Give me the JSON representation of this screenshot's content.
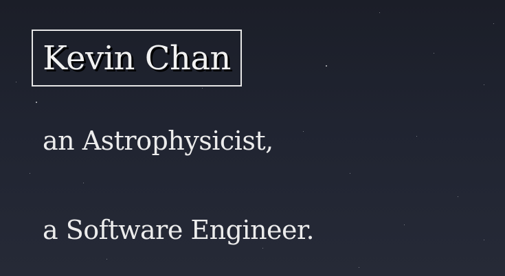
{
  "hero": {
    "name": "Kevin Chan",
    "taglines": [
      "an Astrophysicist,",
      "a Software Engineer."
    ]
  },
  "colors": {
    "background_top": "#1b1e28",
    "background_bottom": "#262a37",
    "text": "#ececec",
    "border": "#e7e7e7"
  }
}
